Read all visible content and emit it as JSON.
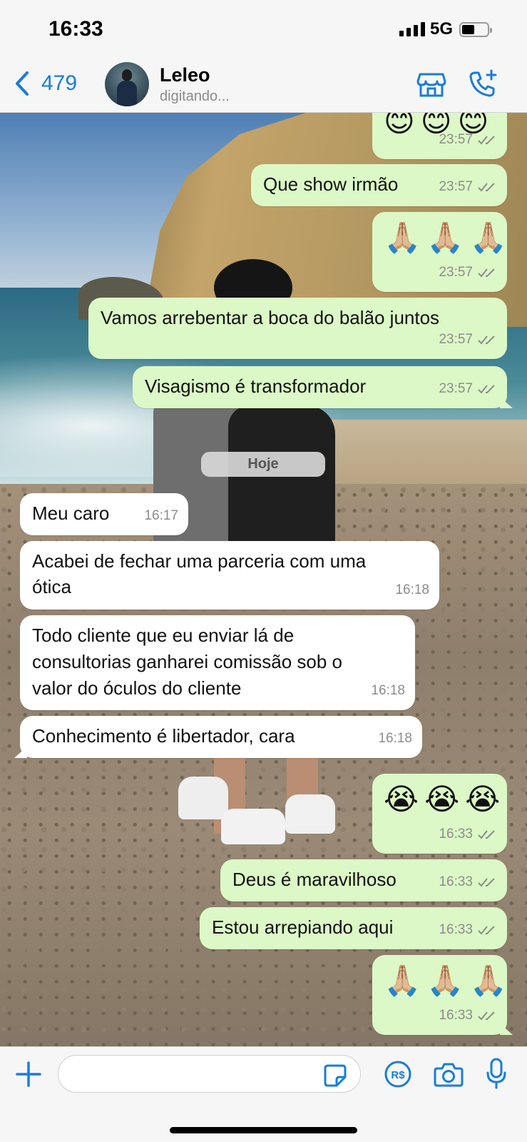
{
  "status_bar": {
    "time": "16:33",
    "network": "5G"
  },
  "header": {
    "back_count": "479",
    "contact_name": "Leleo",
    "contact_status": "digitando...",
    "icons": [
      "back-chevron-icon",
      "store-icon",
      "call-add-icon"
    ]
  },
  "date_separator": "Hoje",
  "messages": [
    {
      "dir": "out",
      "emoji": "😊 😊 😊",
      "time": "23:57"
    },
    {
      "dir": "out",
      "text": "Que show irmão",
      "time": "23:57"
    },
    {
      "dir": "out",
      "emoji": "🙏🏼 🙏🏼 🙏🏼",
      "time": "23:57"
    },
    {
      "dir": "out",
      "text": "Vamos arrebentar a boca do balão juntos",
      "time": "23:57"
    },
    {
      "dir": "out",
      "text": "Visagismo é transformador",
      "time": "23:57"
    },
    {
      "dir": "in",
      "text": "Meu caro",
      "time": "16:17"
    },
    {
      "dir": "in",
      "lines": [
        "Acabei de fechar uma parceria com uma",
        "ótica"
      ],
      "time": "16:18"
    },
    {
      "dir": "in",
      "lines": [
        "Todo cliente que eu enviar lá de",
        "consultorias ganharei comissão sob o",
        "valor do óculos do cliente"
      ],
      "time": "16:18"
    },
    {
      "dir": "in",
      "text": "Conhecimento é libertador, cara",
      "time": "16:18"
    },
    {
      "dir": "out",
      "emoji": "😭 😭 😭",
      "time": "16:33"
    },
    {
      "dir": "out",
      "text": "Deus é maravilhoso",
      "time": "16:33"
    },
    {
      "dir": "out",
      "text": "Estou arrepiando aqui",
      "time": "16:33"
    },
    {
      "dir": "out",
      "emoji": "🙏🏼 🙏🏼 🙏🏼",
      "time": "16:33"
    }
  ],
  "composer": {
    "placeholder": "",
    "icons": [
      "plus-icon",
      "sticker-icon",
      "pix-payment-icon",
      "camera-icon",
      "microphone-icon"
    ],
    "pay_label": "R$"
  },
  "colors": {
    "accent": "#1a7cd8",
    "outgoing": "#dcf8c6",
    "incoming": "#ffffff"
  }
}
